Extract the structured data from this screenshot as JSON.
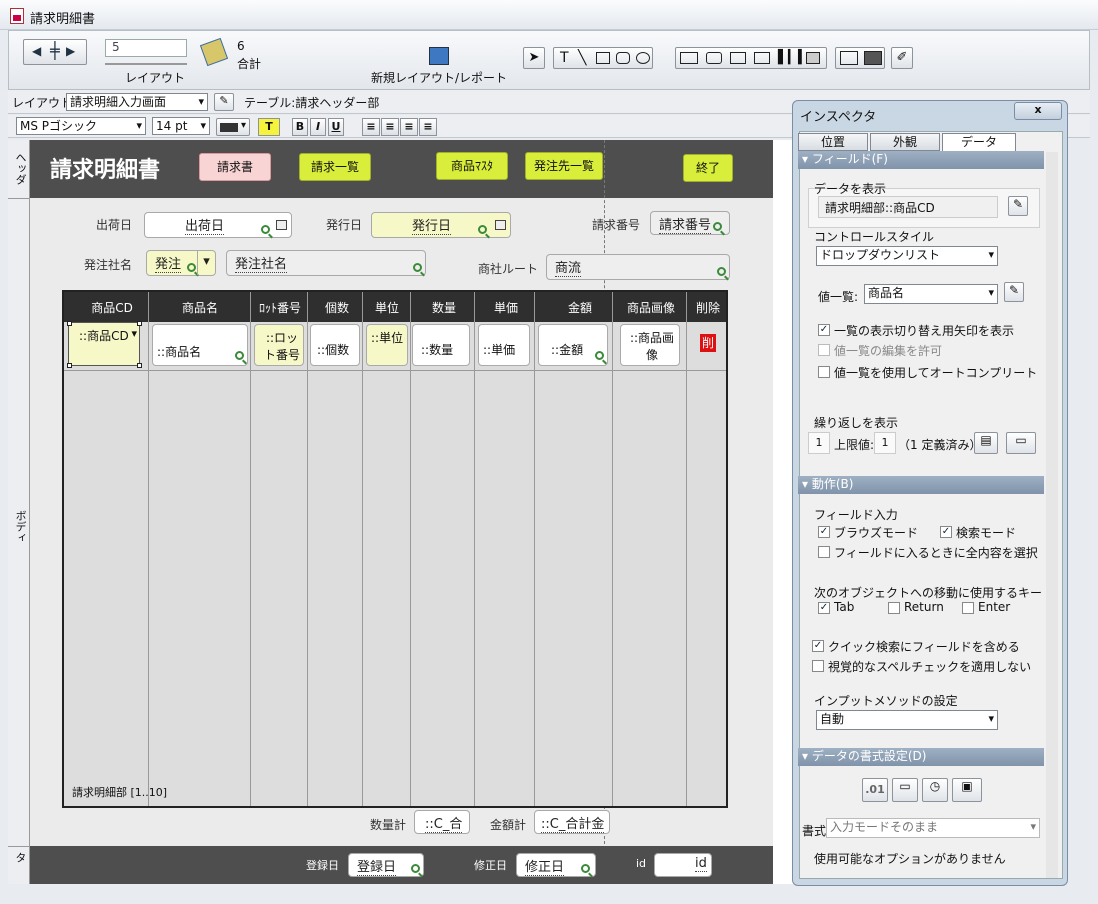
{
  "window": {
    "title": "請求明細書"
  },
  "toolbar": {
    "record_value": "5",
    "layout_label": "レイアウト",
    "count": "6",
    "count_label": "合計",
    "new_layout_label": "新規レイアウト/レポート"
  },
  "layoutbar": {
    "layout_prefix": "レイアウト:",
    "layout_name": "請求明細入力画面",
    "table_label": "テーブル:請求ヘッダー部"
  },
  "fmtbar": {
    "font": "MS Pゴシック",
    "size": "14 pt",
    "text_btn": "T",
    "bold": "B",
    "italic": "I",
    "underline": "U"
  },
  "parts": {
    "header": "ヘッダ",
    "body": "ボディ",
    "footer": "フッタ"
  },
  "header": {
    "title": "請求明細書",
    "buttons": [
      "請求書",
      "請求一覧",
      "商品ﾏｽﾀ",
      "発注先一覧",
      "終了"
    ]
  },
  "body": {
    "ship_date_label": "出荷日",
    "ship_date_field": "出荷日",
    "issue_date_label": "発行日",
    "issue_date_field": "発行日",
    "invoice_no_label": "請求番号",
    "invoice_no_field": "請求番号",
    "client_label": "発注社名",
    "client_code_field": "発注",
    "client_name_field": "発注社名",
    "route_label": "商社ルート",
    "route_field": "商流",
    "columns": [
      "商品CD",
      "商品名",
      "ﾛｯﾄ番号",
      "個数",
      "単位",
      "数量",
      "単価",
      "金額",
      "商品画像",
      "削除"
    ],
    "row_fields": [
      "::商品CD",
      "::商品名",
      "::ロット番号",
      "::個数",
      "::単位",
      "::数量",
      "::単価",
      "::金額",
      "::商品画像",
      "削"
    ],
    "portal_label": "請求明細部 [1..10]",
    "qty_total_label": "数量計",
    "qty_total_field": "::C_合",
    "amt_total_label": "金額計",
    "amt_total_field": "::C_合計金"
  },
  "footer": {
    "reg_label": "登録日",
    "reg_field": "登録日",
    "mod_label": "修正日",
    "mod_field": "修正日",
    "id_label": "id",
    "id_field": "id"
  },
  "inspector": {
    "title": "インスペクタ",
    "tabs": [
      "位置",
      "外観",
      "データ"
    ],
    "field_section": "フィールド(F)",
    "display_data_label": "データを表示",
    "display_data_value": "請求明細部::商品CD",
    "control_style_label": "コントロールスタイル",
    "control_style_value": "ドロップダウンリスト",
    "value_list_label": "値一覧:",
    "value_list_value": "商品名",
    "opt_show_arrow": "一覧の表示切り替え用矢印を表示",
    "opt_allow_edit": "値一覧の編集を許可",
    "opt_autocomplete": "値一覧を使用してオートコンプリート",
    "repeat_label": "繰り返しを表示",
    "repeat_value": "1",
    "max_label": "上限値:",
    "max_value": "1",
    "defined_label": "（1 定義済み）",
    "behavior_section": "動作(B)",
    "field_entry_label": "フィールド入力",
    "browse_mode": "ブラウズモード",
    "find_mode": "検索モード",
    "select_all": "フィールドに入るときに全内容を選択",
    "next_obj_label": "次のオブジェクトへの移動に使用するキー",
    "key_tab": "Tab",
    "key_return": "Return",
    "key_enter": "Enter",
    "quick_find": "クイック検索にフィールドを含める",
    "no_spell": "視覚的なスペルチェックを適用しない",
    "ime_label": "インプットメソッドの設定",
    "ime_value": "自動",
    "format_section": "データの書式設定(D)",
    "format_num": ".01",
    "format_label": "書式",
    "format_value": "入力モードそのまま",
    "no_options": "使用可能なオプションがありません"
  }
}
